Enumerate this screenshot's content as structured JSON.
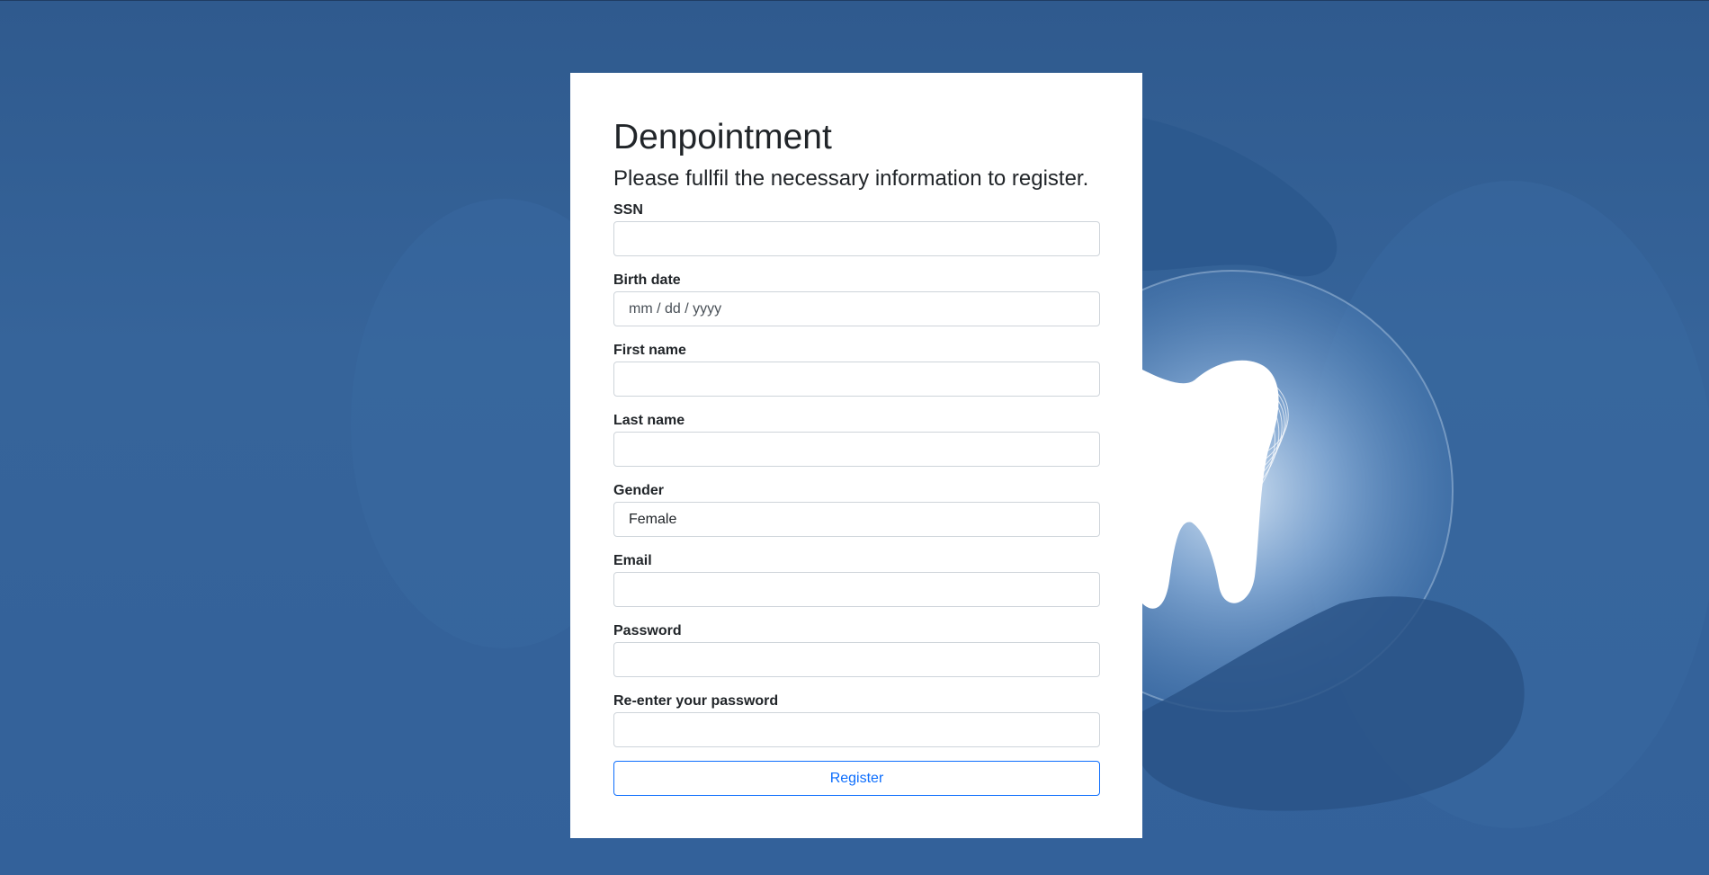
{
  "app": {
    "title": "Denpointment",
    "subtitle": "Please fullfil the necessary information to register."
  },
  "form": {
    "fields": [
      {
        "key": "ssn",
        "label": "SSN",
        "value": ""
      },
      {
        "key": "birth_date",
        "label": "Birth date",
        "value": "mm / dd / yyyy"
      },
      {
        "key": "first_name",
        "label": "First name",
        "value": ""
      },
      {
        "key": "last_name",
        "label": "Last name",
        "value": ""
      },
      {
        "key": "gender",
        "label": "Gender",
        "value": "Female"
      },
      {
        "key": "email",
        "label": "Email",
        "value": ""
      },
      {
        "key": "password",
        "label": "Password",
        "value": ""
      },
      {
        "key": "password_confirm",
        "label": "Re-enter your password",
        "value": ""
      }
    ],
    "submit_label": "Register"
  },
  "colors": {
    "background": "#33619a",
    "card": "#ffffff",
    "accent": "#0d6efd",
    "text": "#212529",
    "input_border": "#ced4da"
  },
  "background_image": {
    "icon": "tooth-in-hands-image"
  }
}
